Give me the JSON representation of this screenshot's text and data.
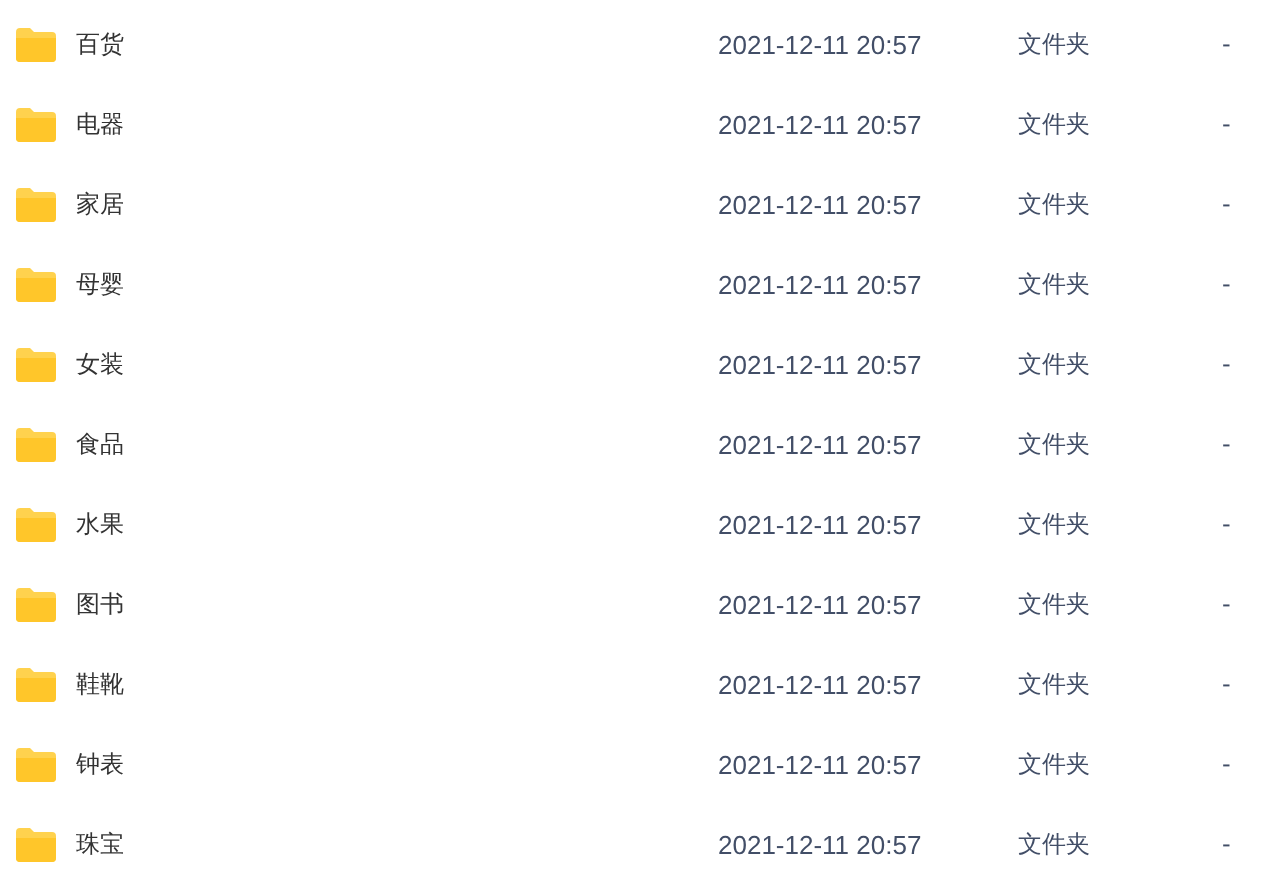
{
  "files": [
    {
      "name": "百货",
      "modified": "2021-12-11 20:57",
      "type": "文件夹",
      "size": "-"
    },
    {
      "name": "电器",
      "modified": "2021-12-11 20:57",
      "type": "文件夹",
      "size": "-"
    },
    {
      "name": "家居",
      "modified": "2021-12-11 20:57",
      "type": "文件夹",
      "size": "-"
    },
    {
      "name": "母婴",
      "modified": "2021-12-11 20:57",
      "type": "文件夹",
      "size": "-"
    },
    {
      "name": "女装",
      "modified": "2021-12-11 20:57",
      "type": "文件夹",
      "size": "-"
    },
    {
      "name": "食品",
      "modified": "2021-12-11 20:57",
      "type": "文件夹",
      "size": "-"
    },
    {
      "name": "水果",
      "modified": "2021-12-11 20:57",
      "type": "文件夹",
      "size": "-"
    },
    {
      "name": "图书",
      "modified": "2021-12-11 20:57",
      "type": "文件夹",
      "size": "-"
    },
    {
      "name": "鞋靴",
      "modified": "2021-12-11 20:57",
      "type": "文件夹",
      "size": "-"
    },
    {
      "name": "钟表",
      "modified": "2021-12-11 20:57",
      "type": "文件夹",
      "size": "-"
    },
    {
      "name": "珠宝",
      "modified": "2021-12-11 20:57",
      "type": "文件夹",
      "size": "-"
    }
  ]
}
